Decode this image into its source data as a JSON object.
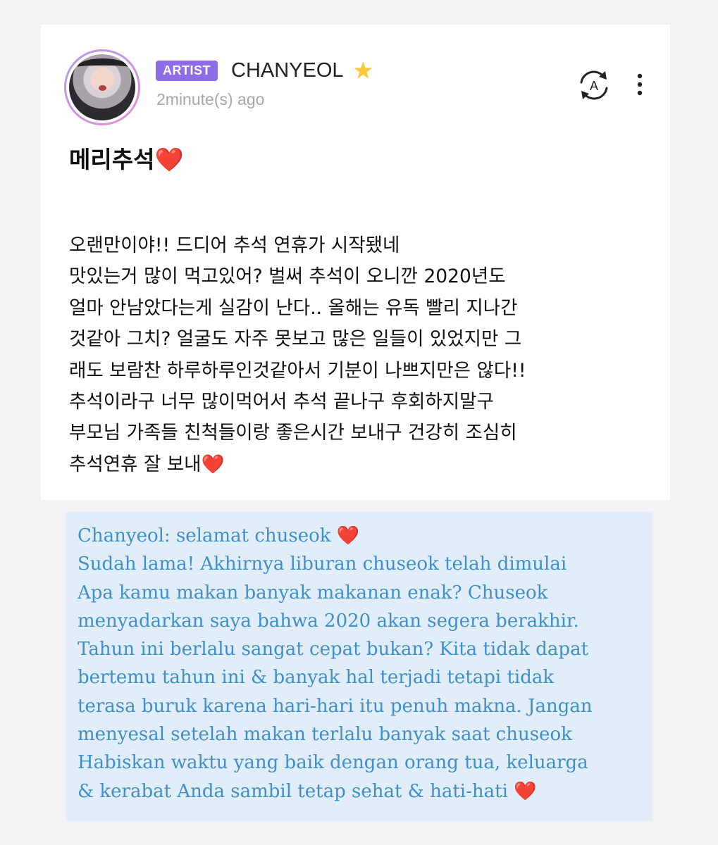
{
  "post": {
    "author": {
      "badge": "ARTIST",
      "name": "CHANYEOL",
      "verified_icon": "star-icon",
      "avatar_icon": "avatar"
    },
    "timestamp": "2minute(s) ago",
    "actions": {
      "translate_icon": "translate-icon",
      "more_icon": "more-vertical-icon"
    },
    "title": "메리추석",
    "title_emoji": "❤️",
    "body": "오랜만이야!! 드디어 추석 연휴가 시작됐네\n맛있는거 많이 먹고있어? 벌써 추석이 오니깐 2020년도\n얼마 안남았다는게 실감이 난다.. 올해는 유독 빨리 지나간\n것같아 그치? 얼굴도 자주 못보고 많은 일들이 있었지만 그\n래도 보람찬 하루하루인것같아서 기분이 나쁘지만은 않다!!\n추석이라구 너무 많이먹어서 추석 끝나구 후회하지말구\n부모님 가족들 친척들이랑 좋은시간 보내구 건강히 조심히\n추석연휴 잘 보내",
    "body_emoji": "❤️"
  },
  "translation": {
    "text": "Chanyeol: selamat chuseok ❤️\nSudah lama! Akhirnya liburan chuseok telah dimulai\nApa kamu makan banyak makanan enak? Chuseok\nmenyadarkan saya bahwa 2020 akan segera berakhir.\nTahun ini berlalu sangat cepat bukan? Kita tidak dapat\nbertemu tahun ini & banyak hal terjadi tetapi tidak\nterasa buruk karena hari-hari itu penuh makna. Jangan\nmenyesal setelah makan terlalu banyak saat chuseok\nHabiskan waktu yang baik dengan orang tua, keluarga\n& kerabat Anda sambil tetap sehat & hati-hati ❤️"
  },
  "colors": {
    "badge": "#8f6bea",
    "heart": "#e8322a",
    "translation_text": "#3f8fc9",
    "translation_bg": "#e1edf8"
  }
}
